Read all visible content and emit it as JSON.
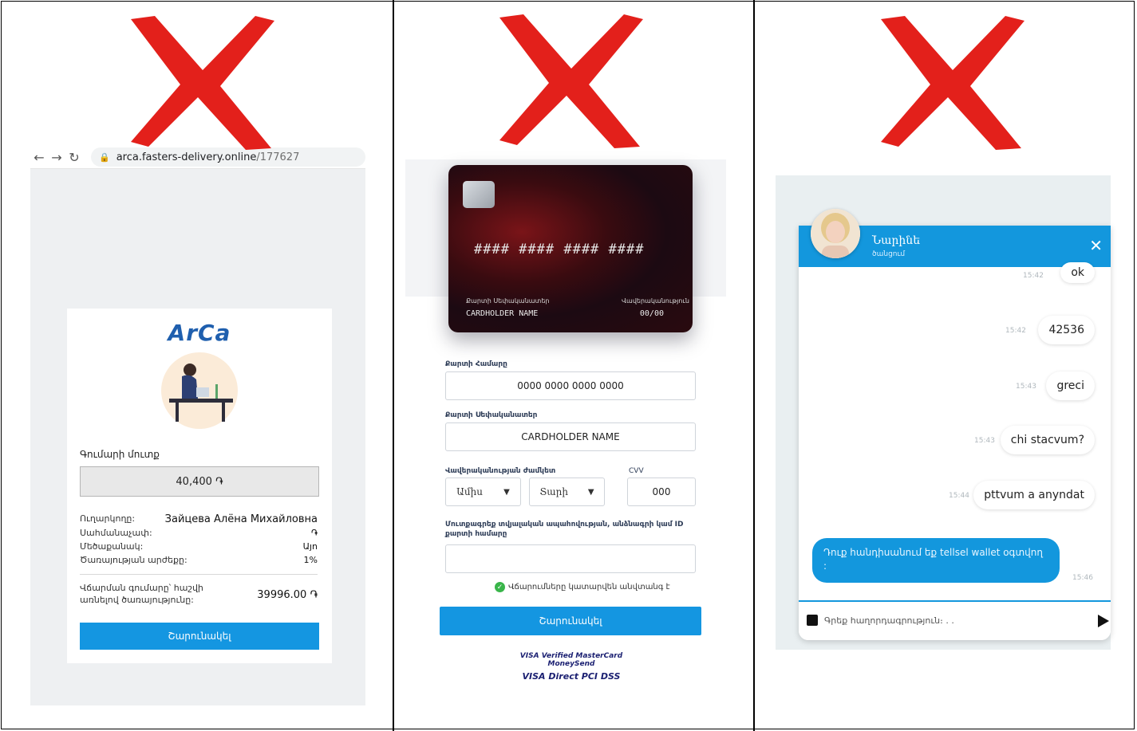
{
  "colors": {
    "accent": "#1496e1",
    "cross": "#e3201b",
    "chat_header": "#1397dd"
  },
  "icons": [
    "red-cross-icon",
    "back-arrow-icon",
    "forward-arrow-icon",
    "reload-icon",
    "lock-icon",
    "shield-check-icon",
    "image-attach-icon",
    "send-icon",
    "close-icon"
  ],
  "panel1": {
    "url_host": "arca.fasters-delivery.online",
    "url_path": "/177627",
    "logo": "ArCa",
    "amount_label": "Գումարի մուտք",
    "amount_value": "40,400 ֏",
    "rows": [
      {
        "label": "Ուղարկողը:",
        "value": "Зайцева Алёна Михайловна"
      },
      {
        "label": "Սահմանաչափ:",
        "value": "֏"
      },
      {
        "label": "Մեծաքանակ:",
        "value": "Այո"
      },
      {
        "label": "Ծառայության արժեքը:",
        "value": "1%"
      }
    ],
    "total_label": "Վճարման գումարը՝ հաշվի առնելով ծառայությունը:",
    "total_value": "39996.00 ֏",
    "pay_button": "Շարունակել"
  },
  "panel2": {
    "card_number": "#### #### #### ####",
    "card_holder_label": "Քարտի Սեփականատեր",
    "card_holder_value": "CARDHOLDER NAME",
    "card_expiry_label": "Վավերականություն",
    "card_expiry_value": "00/00",
    "number_label": "Քարտի Համարը",
    "number_placeholder": "0000 0000 0000 0000",
    "holder_label": "Քարտի Սեփականատեր",
    "holder_placeholder": "CARDHOLDER NAME",
    "expiry_label": "Վավերականության ժամկետ",
    "month_label": "Ամիս",
    "year_label": "Տարի",
    "cvv_label": "CVV",
    "cvv_placeholder": "000",
    "extra_label": "Մուտքագրեք տվյալական ապահովության, անձնագրի կամ ID քարտի համարը",
    "secure_note": "Վճարումները կատարվեն անվտանգ է",
    "pay_button": "Շարունակել",
    "logo_line1": "VISA Verified MasterCard MoneySend",
    "logo_line2": "VISA Direct PCI DSS"
  },
  "panel3": {
    "agent_name": "Նարինե",
    "agent_status": "ծանցում",
    "messages": [
      {
        "text": "ok",
        "time": "15:42"
      },
      {
        "text": "42536",
        "time": "15:42"
      },
      {
        "text": "greci",
        "time": "15:43"
      },
      {
        "text": "chi stacvum?",
        "time": "15:43"
      },
      {
        "text": "pttvum a anyndat",
        "time": "15:44"
      }
    ],
    "bot_message": "Դուք հանդիսանում եք tellsel wallet օգտվող :",
    "bot_time": "15:46",
    "input_placeholder": "Գրեք հաղորդագրություն։ . ."
  }
}
